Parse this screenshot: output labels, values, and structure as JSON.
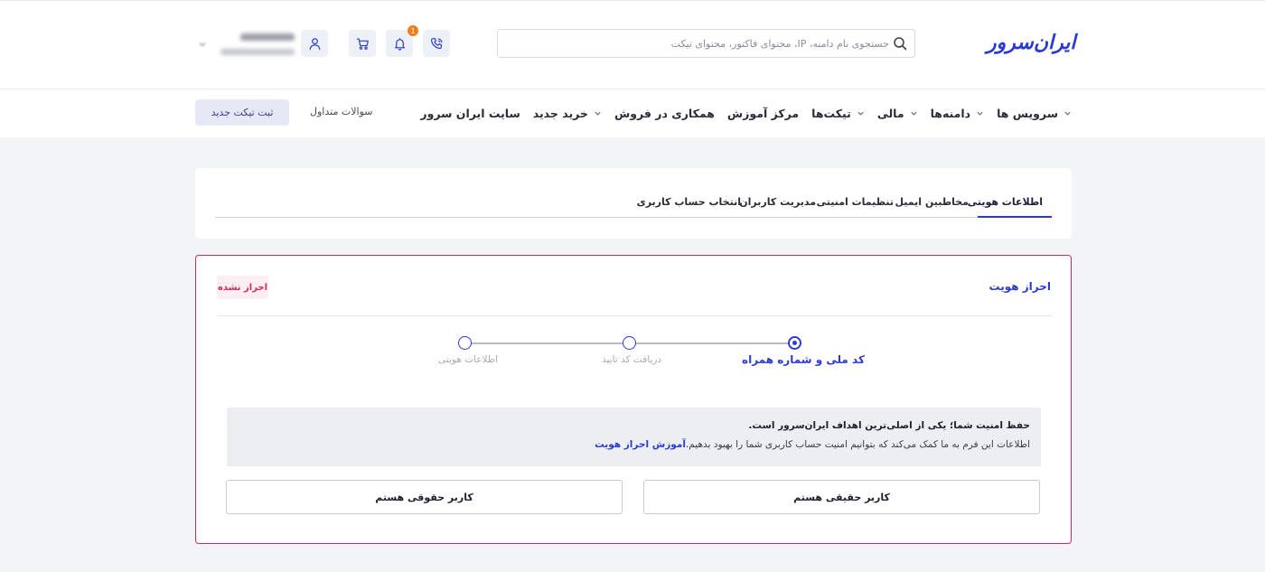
{
  "header": {
    "logo_text": "ایران‌سرور",
    "search_placeholder": "جستجوی نام دامنه، IP، محتوای فاکتور، محتوای تیکت",
    "notification_count": "1",
    "icons": [
      "phone-icon",
      "bell-icon",
      "cart-icon",
      "user-icon"
    ]
  },
  "nav": {
    "items": [
      {
        "label": "سرویس ها",
        "has_dropdown": true
      },
      {
        "label": "دامنه‌ها",
        "has_dropdown": true
      },
      {
        "label": "مالی",
        "has_dropdown": true
      },
      {
        "label": "تیکت‌ها",
        "has_dropdown": true
      },
      {
        "label": "مرکز آموزش",
        "has_dropdown": false
      },
      {
        "label": "همکاری در فروش",
        "has_dropdown": false
      },
      {
        "label": "خرید جدید",
        "has_dropdown": true
      },
      {
        "label": "سایت ایران سرور",
        "has_dropdown": false
      }
    ],
    "faq_label": "سوالات متداول",
    "new_ticket_label": "ثبت تیکت جدید"
  },
  "tabs": {
    "items": [
      "اطلاعات هویتی",
      "مخاطبین ایمیل",
      "تنظیمات امنیتی",
      "مدیریت کاربران",
      "انتخاب حساب کاربری"
    ],
    "active": "اطلاعات هویتی"
  },
  "kyc": {
    "title": "احراز هویت",
    "status_badge": "احراز نشده",
    "steps": [
      {
        "label": "کد ملی و شماره همراه",
        "state": "active"
      },
      {
        "label": "دریافت کد تایید",
        "state": "pending"
      },
      {
        "label": "اطلاعات هویتی",
        "state": "pending"
      }
    ],
    "info_heading": "حفظ امنیت شما؛ یکی از اصلی‌ترین اهداف ایران‌سرور است.",
    "info_text": "اطلاعات این فرم به ما کمک می‌کند که بتوانیم امنیت حساب کاربری شما را بهبود بدهیم.",
    "info_link": "آموزش احراز هویت",
    "natural_person_label": "کاربر حقیقی هستم",
    "legal_person_label": "کاربر حقوقی هستم"
  },
  "colors": {
    "brand": "#2b3bd1",
    "danger": "#d6295a",
    "badge_orange": "#f07c1a",
    "background": "#f3f4f7"
  }
}
